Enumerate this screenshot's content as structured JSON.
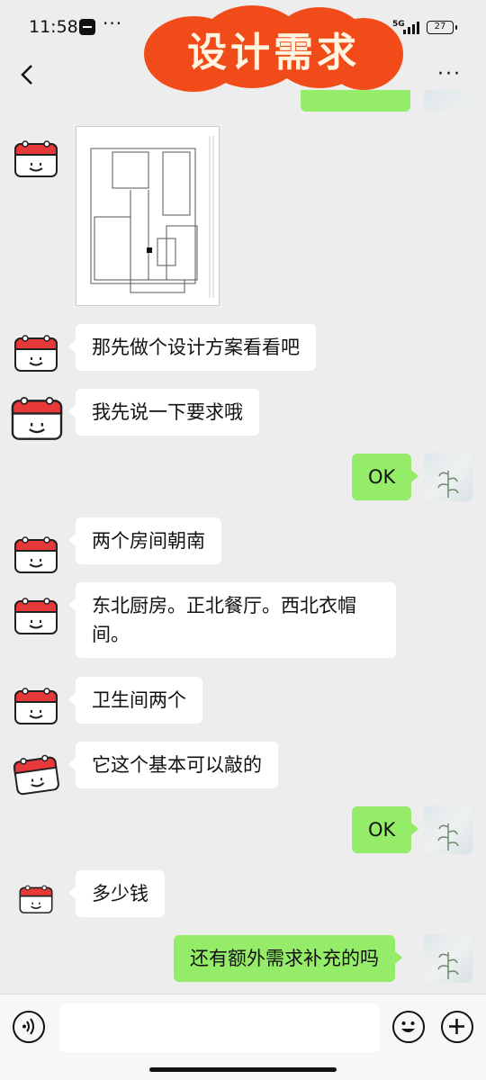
{
  "status_bar": {
    "time": "11:58",
    "dots": "···",
    "network": "5G",
    "battery": "27"
  },
  "banner": {
    "title": "设计需求"
  },
  "header": {
    "back_icon": "chevron-left-icon",
    "more_label": "···"
  },
  "messages": [
    {
      "side": "left",
      "type": "image",
      "content": "floor-plan"
    },
    {
      "side": "left",
      "text": "那先做个设计方案看看吧"
    },
    {
      "side": "left",
      "text": "我先说一下要求哦"
    },
    {
      "side": "right",
      "text": "OK"
    },
    {
      "side": "left",
      "text": "两个房间朝南"
    },
    {
      "side": "left",
      "text_line1": "东北厨房。正北餐厅。西北衣帽",
      "text_line2": "间。"
    },
    {
      "side": "left",
      "text": "卫生间两个"
    },
    {
      "side": "left",
      "text": "它这个基本可以敲的"
    },
    {
      "side": "right",
      "text": "OK"
    },
    {
      "side": "left",
      "text": "多少钱"
    },
    {
      "side": "right",
      "text": "还有额外需求补充的吗"
    }
  ],
  "input_bar": {
    "voice_icon": "voice-icon",
    "emoji_icon": "emoji-icon",
    "add_icon": "plus-icon",
    "input_value": ""
  },
  "colors": {
    "background": "#ededed",
    "bubble_self": "#95ec69",
    "bubble_other": "#ffffff",
    "banner": "#f24b1a"
  }
}
